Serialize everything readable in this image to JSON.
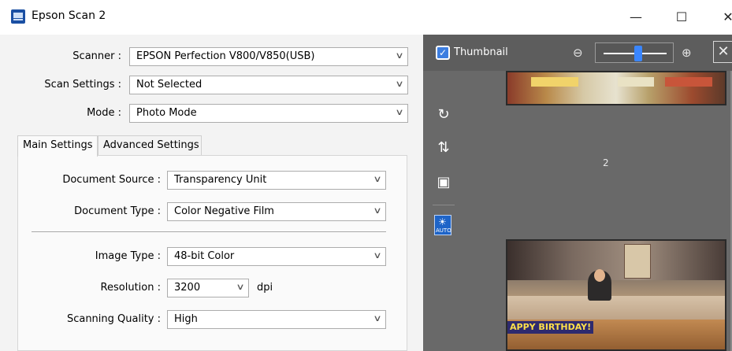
{
  "window": {
    "title": "Epson Scan 2",
    "minimize_glyph": "—",
    "maximize_glyph": "☐",
    "close_glyph": "✕"
  },
  "settings": {
    "scanner": {
      "label": "Scanner :",
      "value": "EPSON Perfection V800/V850(USB)"
    },
    "scan_settings": {
      "label": "Scan Settings :",
      "value": "Not Selected"
    },
    "mode": {
      "label": "Mode :",
      "value": "Photo Mode"
    }
  },
  "tabs": [
    {
      "label": "Main Settings",
      "active": true
    },
    {
      "label": "Advanced Settings",
      "active": false
    }
  ],
  "main": {
    "document_source": {
      "label": "Document Source :",
      "value": "Transparency Unit"
    },
    "document_type": {
      "label": "Document Type :",
      "value": "Color Negative Film"
    },
    "image_type": {
      "label": "Image Type :",
      "value": "48-bit Color"
    },
    "resolution": {
      "label": "Resolution :",
      "value": "3200",
      "unit": "dpi"
    },
    "scanning_quality": {
      "label": "Scanning Quality :",
      "value": "High"
    }
  },
  "preview": {
    "thumbnail_label": "Thumbnail",
    "thumbnail_checked": true,
    "zoom_level": 0.55,
    "frame_number": "2",
    "auto_label": "AUTO",
    "photo_banner_text": "APPY BIRTHDAY!",
    "icons": [
      "rotate-icon",
      "flip-icon",
      "select-all-icon",
      "auto-exposure-icon"
    ]
  },
  "colors": {
    "accent": "#3a86ff",
    "preview_bg": "#696969",
    "auto_button": "#1e64c8"
  }
}
